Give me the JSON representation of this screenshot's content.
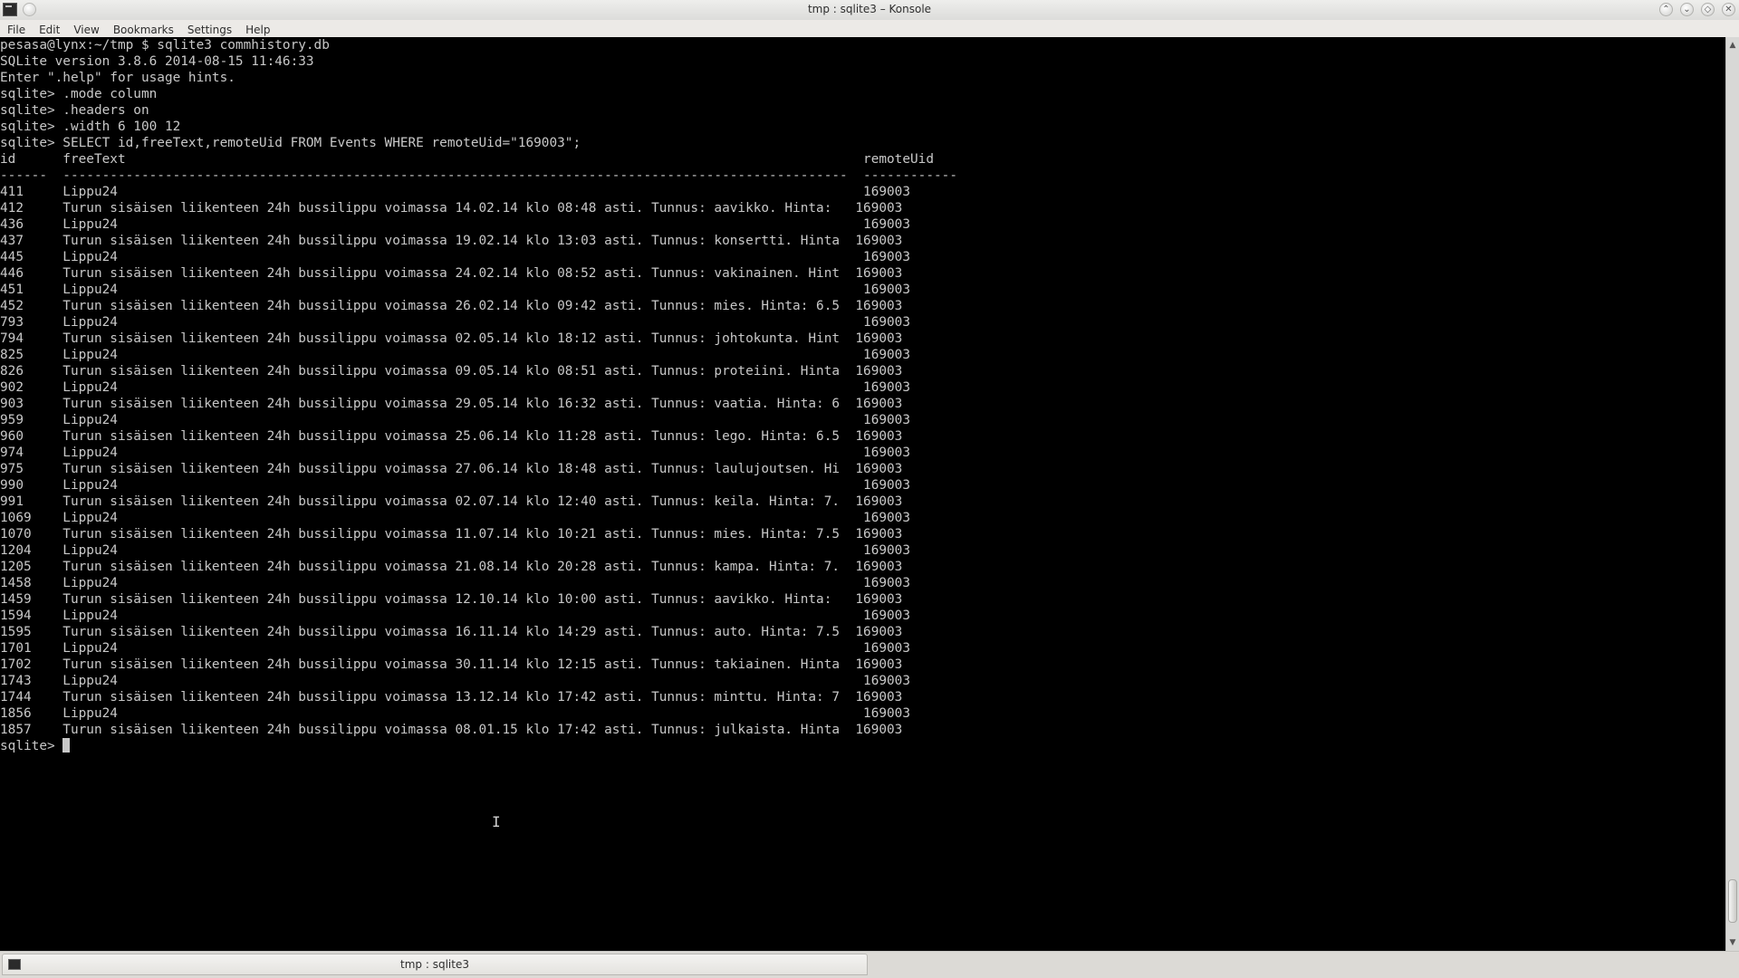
{
  "window": {
    "title": "tmp : sqlite3 – Konsole",
    "controls": {
      "up": "⌃",
      "minimize": "⌄",
      "maximize": "◇",
      "close": "✕"
    }
  },
  "menu": [
    "File",
    "Edit",
    "View",
    "Bookmarks",
    "Settings",
    "Help"
  ],
  "terminal": {
    "lines": [
      "pesasa@lynx:~/tmp $ sqlite3 commhistory.db",
      "SQLite version 3.8.6 2014-08-15 11:46:33",
      "Enter \".help\" for usage hints.",
      "sqlite> .mode column",
      "sqlite> .headers on",
      "sqlite> .width 6 100 12",
      "sqlite> SELECT id,freeText,remoteUid FROM Events WHERE remoteUid=\"169003\";",
      "id      freeText                                                                                              remoteUid",
      "------  ----------------------------------------------------------------------------------------------------  ------------",
      "411     Lippu24                                                                                               169003",
      "412     Turun sisäisen liikenteen 24h bussilippu voimassa 14.02.14 klo 08:48 asti. Tunnus: aavikko. Hinta:   169003",
      "436     Lippu24                                                                                               169003",
      "437     Turun sisäisen liikenteen 24h bussilippu voimassa 19.02.14 klo 13:03 asti. Tunnus: konsertti. Hinta  169003",
      "445     Lippu24                                                                                               169003",
      "446     Turun sisäisen liikenteen 24h bussilippu voimassa 24.02.14 klo 08:52 asti. Tunnus: vakinainen. Hint  169003",
      "451     Lippu24                                                                                               169003",
      "452     Turun sisäisen liikenteen 24h bussilippu voimassa 26.02.14 klo 09:42 asti. Tunnus: mies. Hinta: 6.5  169003",
      "793     Lippu24                                                                                               169003",
      "794     Turun sisäisen liikenteen 24h bussilippu voimassa 02.05.14 klo 18:12 asti. Tunnus: johtokunta. Hint  169003",
      "825     Lippu24                                                                                               169003",
      "826     Turun sisäisen liikenteen 24h bussilippu voimassa 09.05.14 klo 08:51 asti. Tunnus: proteiini. Hinta  169003",
      "902     Lippu24                                                                                               169003",
      "903     Turun sisäisen liikenteen 24h bussilippu voimassa 29.05.14 klo 16:32 asti. Tunnus: vaatia. Hinta: 6  169003",
      "959     Lippu24                                                                                               169003",
      "960     Turun sisäisen liikenteen 24h bussilippu voimassa 25.06.14 klo 11:28 asti. Tunnus: lego. Hinta: 6.5  169003",
      "974     Lippu24                                                                                               169003",
      "975     Turun sisäisen liikenteen 24h bussilippu voimassa 27.06.14 klo 18:48 asti. Tunnus: laulujoutsen. Hi  169003",
      "990     Lippu24                                                                                               169003",
      "991     Turun sisäisen liikenteen 24h bussilippu voimassa 02.07.14 klo 12:40 asti. Tunnus: keila. Hinta: 7.  169003",
      "1069    Lippu24                                                                                               169003",
      "1070    Turun sisäisen liikenteen 24h bussilippu voimassa 11.07.14 klo 10:21 asti. Tunnus: mies. Hinta: 7.5  169003",
      "1204    Lippu24                                                                                               169003",
      "1205    Turun sisäisen liikenteen 24h bussilippu voimassa 21.08.14 klo 20:28 asti. Tunnus: kampa. Hinta: 7.  169003",
      "1458    Lippu24                                                                                               169003",
      "1459    Turun sisäisen liikenteen 24h bussilippu voimassa 12.10.14 klo 10:00 asti. Tunnus: aavikko. Hinta:   169003",
      "1594    Lippu24                                                                                               169003",
      "1595    Turun sisäisen liikenteen 24h bussilippu voimassa 16.11.14 klo 14:29 asti. Tunnus: auto. Hinta: 7.5  169003",
      "1701    Lippu24                                                                                               169003",
      "1702    Turun sisäisen liikenteen 24h bussilippu voimassa 30.11.14 klo 12:15 asti. Tunnus: takiainen. Hinta  169003",
      "1743    Lippu24                                                                                               169003",
      "1744    Turun sisäisen liikenteen 24h bussilippu voimassa 13.12.14 klo 17:42 asti. Tunnus: minttu. Hinta: 7  169003",
      "1856    Lippu24                                                                                               169003",
      "1857    Turun sisäisen liikenteen 24h bussilippu voimassa 08.01.15 klo 17:42 asti. Tunnus: julkaista. Hinta  169003"
    ],
    "prompt": "sqlite> ",
    "foreground": "#c8c8c8",
    "background": "#000000"
  },
  "tabs": [
    {
      "label": "tmp : sqlite3"
    }
  ]
}
